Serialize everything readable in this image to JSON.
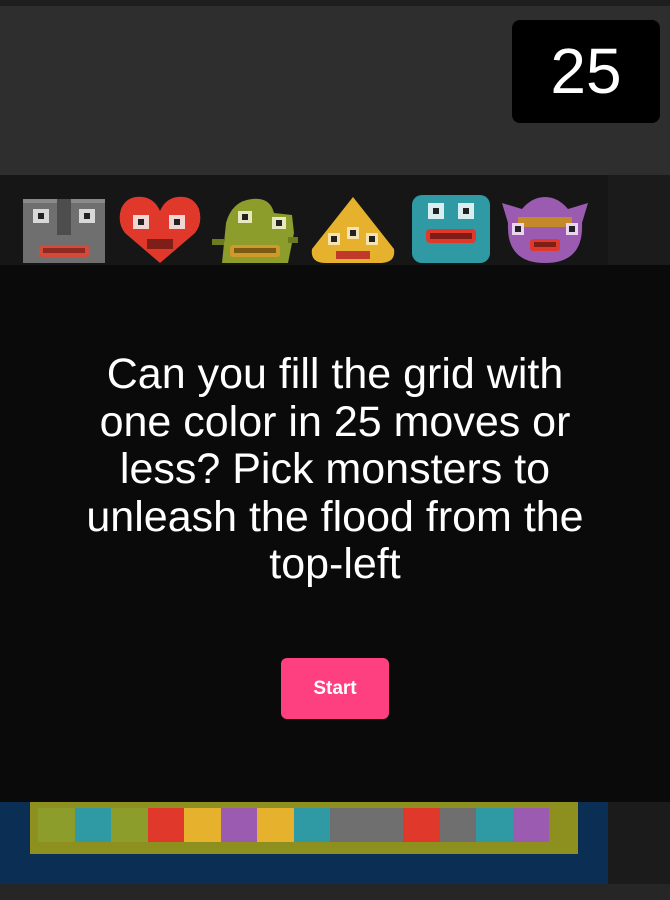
{
  "header": {
    "moves": "25"
  },
  "monsters": [
    {
      "name": "grey-robot",
      "color": "#6f6f6f"
    },
    {
      "name": "red-heart",
      "color": "#e0392b"
    },
    {
      "name": "green-lizard",
      "color": "#8c9d2b"
    },
    {
      "name": "yellow-cone",
      "color": "#e6b22d"
    },
    {
      "name": "teal-blob",
      "color": "#2f9aa3"
    },
    {
      "name": "purple-fish",
      "color": "#9a5bb0"
    }
  ],
  "overlay": {
    "message": "Can you fill the grid with one color in 25 moves or less? Pick monsters to unleash the flood from the top-left",
    "start_label": "Start"
  },
  "board": {
    "row_colors": [
      "#8c9d2b",
      "#2f9aa3",
      "#8c9d2b",
      "#e0392b",
      "#e6b22d",
      "#9a5bb0",
      "#e6b22d",
      "#2f9aa3",
      "#6f6f6f",
      "#6f6f6f",
      "#e0392b",
      "#6f6f6f",
      "#2f9aa3",
      "#9a5bb0"
    ]
  }
}
